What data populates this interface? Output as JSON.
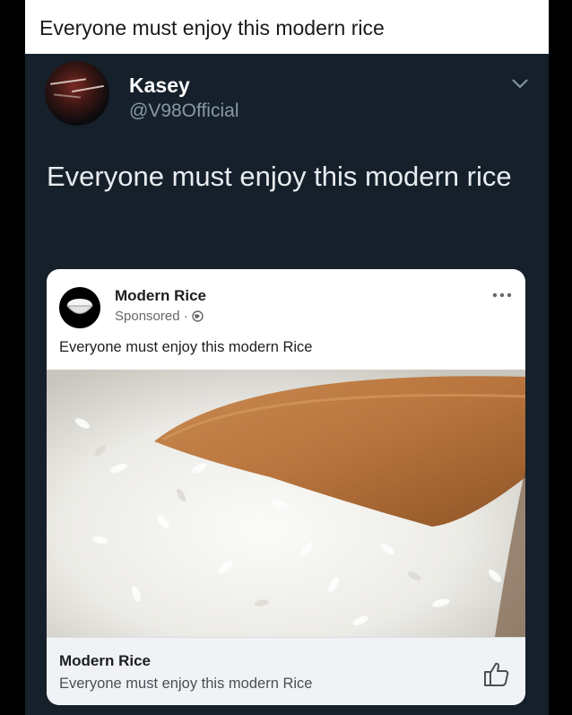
{
  "caption": {
    "text": "Everyone must enjoy this modern rice"
  },
  "tweet": {
    "user_name": "Kasey",
    "user_handle": "@V98Official",
    "text": "Everyone must enjoy this modern rice"
  },
  "fb_post": {
    "page_name": "Modern Rice",
    "sponsored_label": "Sponsored ·",
    "text": "Everyone must enjoy this modern Rice",
    "link_title": "Modern Rice",
    "link_description": "Everyone must enjoy this modern Rice"
  },
  "icons": {
    "tweet_menu": "chevron-down-icon",
    "audience": "globe-icon",
    "post_menu": "more-options-icon",
    "reaction": "thumbs-up-icon"
  },
  "colors": {
    "tweet_background": "#15202b",
    "page_background": "#000000",
    "handle_gray": "#8899a6"
  }
}
